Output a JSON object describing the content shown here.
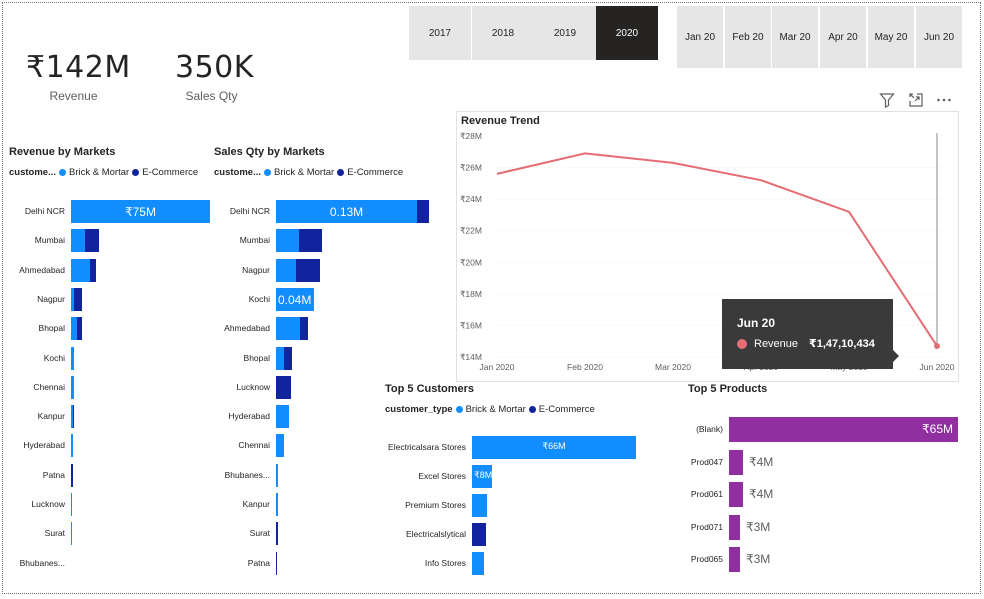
{
  "colors": {
    "brick_mortar": "#118dff",
    "ecommerce": "#12239e",
    "revenue_line": "#e66c73",
    "products_bar": "#8f2fa0",
    "active_slicer": "#252423"
  },
  "kpis": {
    "revenue": {
      "value": "₹142M",
      "label": "Revenue"
    },
    "sales_qty": {
      "value": "350K",
      "label": "Sales Qty"
    }
  },
  "year_slicer": {
    "items": [
      "2017",
      "2018",
      "2019",
      "2020"
    ],
    "selected": "2020"
  },
  "month_slicer": {
    "items": [
      "Jan 20",
      "Feb 20",
      "Mar 20",
      "Apr 20",
      "May 20",
      "Jun 20"
    ]
  },
  "visual_header_icons": [
    "filter-icon",
    "focus-mode-icon",
    "more-options-icon"
  ],
  "legend": {
    "title_short": "custome...",
    "title_full": "customer_type",
    "brick": "Brick & Mortar",
    "ecom": "E-Commerce"
  },
  "revenue_by_markets": {
    "title": "Revenue by Markets",
    "rows": [
      {
        "market": "Delhi NCR",
        "brick": 1.0,
        "ecom": 0.0,
        "label": "₹75M"
      },
      {
        "market": "Mumbai",
        "brick": 0.1,
        "ecom": 0.1,
        "label": ""
      },
      {
        "market": "Ahmedabad",
        "brick": 0.14,
        "ecom": 0.04,
        "label": ""
      },
      {
        "market": "Nagpur",
        "brick": 0.025,
        "ecom": 0.06,
        "label": ""
      },
      {
        "market": "Bhopal",
        "brick": 0.04,
        "ecom": 0.035,
        "label": ""
      },
      {
        "market": "Kochi",
        "brick": 0.025,
        "ecom": 0.0,
        "label": ""
      },
      {
        "market": "Chennai",
        "brick": 0.02,
        "ecom": 0.0,
        "label": ""
      },
      {
        "market": "Kanpur",
        "brick": 0.015,
        "ecom": 0.01,
        "label": ""
      },
      {
        "market": "Hyderabad",
        "brick": 0.012,
        "ecom": 0.0,
        "label": ""
      },
      {
        "market": "Patna",
        "brick": 0.0,
        "ecom": 0.012,
        "label": ""
      },
      {
        "market": "Lucknow",
        "brick": 0.008,
        "ecom": 0.0,
        "label": ""
      },
      {
        "market": "Surat",
        "brick": 0.004,
        "ecom": 0.0,
        "label": ""
      },
      {
        "market": "Bhubanes...",
        "brick": 0.003,
        "ecom": 0.0,
        "label": ""
      }
    ]
  },
  "sales_qty_by_markets": {
    "title": "Sales Qty by Markets",
    "rows": [
      {
        "market": "Delhi NCR",
        "brick": 0.92,
        "ecom": 0.08,
        "label": "0.13M"
      },
      {
        "market": "Mumbai",
        "brick": 0.15,
        "ecom": 0.15,
        "label": ""
      },
      {
        "market": "Nagpur",
        "brick": 0.13,
        "ecom": 0.16,
        "label": ""
      },
      {
        "market": "Kochi",
        "brick": 0.25,
        "ecom": 0.0,
        "label": "0.04M"
      },
      {
        "market": "Ahmedabad",
        "brick": 0.16,
        "ecom": 0.05,
        "label": ""
      },
      {
        "market": "Bhopal",
        "brick": 0.05,
        "ecom": 0.05,
        "label": ""
      },
      {
        "market": "Lucknow",
        "brick": 0.0,
        "ecom": 0.1,
        "label": ""
      },
      {
        "market": "Hyderabad",
        "brick": 0.085,
        "ecom": 0.0,
        "label": ""
      },
      {
        "market": "Chennai",
        "brick": 0.05,
        "ecom": 0.0,
        "label": ""
      },
      {
        "market": "Bhubanes...",
        "brick": 0.015,
        "ecom": 0.0,
        "label": ""
      },
      {
        "market": "Kanpur",
        "brick": 0.012,
        "ecom": 0.0,
        "label": ""
      },
      {
        "market": "Surat",
        "brick": 0.0,
        "ecom": 0.012,
        "label": ""
      },
      {
        "market": "Patna",
        "brick": 0.0,
        "ecom": 0.008,
        "label": ""
      }
    ]
  },
  "top_customers": {
    "title": "Top 5 Customers",
    "rows": [
      {
        "name": "Electricalsara Stores",
        "brick": 1.0,
        "ecom": 0.0,
        "label": "₹66M"
      },
      {
        "name": "Excel Stores",
        "brick": 0.12,
        "ecom": 0.0,
        "label": "₹8M"
      },
      {
        "name": "Premium Stores",
        "brick": 0.09,
        "ecom": 0.0,
        "label": ""
      },
      {
        "name": "Electricalslytical",
        "brick": 0.0,
        "ecom": 0.085,
        "label": ""
      },
      {
        "name": "Info Stores",
        "brick": 0.075,
        "ecom": 0.0,
        "label": ""
      }
    ]
  },
  "top_products": {
    "title": "Top 5 Products",
    "rows": [
      {
        "name": "(Blank)",
        "value": 65,
        "label": "₹65M"
      },
      {
        "name": "Prod047",
        "value": 4,
        "label": "₹4M"
      },
      {
        "name": "Prod061",
        "value": 4,
        "label": "₹4M"
      },
      {
        "name": "Prod071",
        "value": 3,
        "label": "₹3M"
      },
      {
        "name": "Prod065",
        "value": 3,
        "label": "₹3M"
      }
    ]
  },
  "tooltip": {
    "title": "Jun 20",
    "series": "Revenue",
    "value": "₹1,47,10,434"
  },
  "chart_data": {
    "type": "line",
    "title": "Revenue Trend",
    "x": [
      "Jan 2020",
      "Feb 2020",
      "Mar 2020",
      "Apr 2020",
      "May 2020",
      "Jun 2020"
    ],
    "series": [
      {
        "name": "Revenue",
        "values": [
          25.6,
          26.9,
          26.3,
          25.2,
          23.2,
          14.7
        ]
      }
    ],
    "yticks": [
      "₹14M",
      "₹16M",
      "₹18M",
      "₹20M",
      "₹22M",
      "₹24M",
      "₹26M",
      "₹28M"
    ],
    "ylim": [
      14,
      28
    ],
    "grid": true
  }
}
